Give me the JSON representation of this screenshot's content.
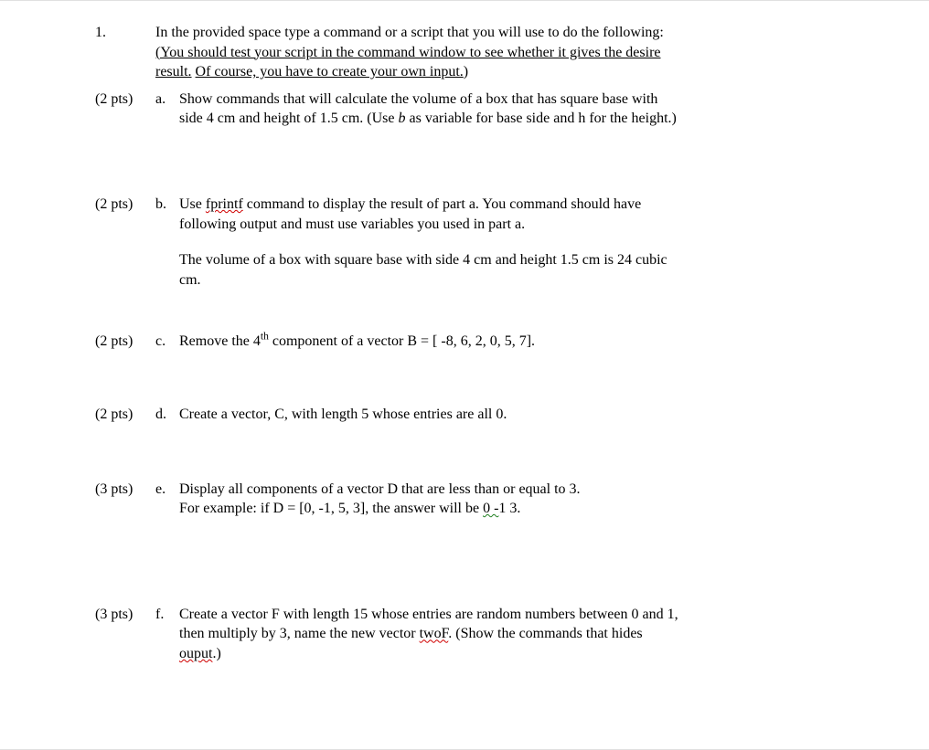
{
  "question_number": "1.",
  "intro": {
    "line1": "In the provided space type a command or a script that you will use to do the following:",
    "underlined_1": "(You should test your script in the command window to see whether it gives the desire",
    "underlined_2a": "result.",
    "underlined_2b": "Of course, you have to create your own input.",
    "paren_close": ")"
  },
  "parts": {
    "a": {
      "pts": "(2 pts)",
      "letter": "a.",
      "line1_a": "Show commands that will calculate the volume of a box that has square base with",
      "line2_pre": "side 4 cm and height of 1.5 cm. (Use ",
      "line2_var": "b",
      "line2_post": " as variable for base side and h for the height.)"
    },
    "b": {
      "pts": "(2 pts)",
      "letter": "b.",
      "line1_pre": "Use ",
      "line1_cmd": "fprintf",
      "line1_post": " command to display the result of part a. You command should have",
      "line2": "following output and must use variables you used in part a.",
      "line3": "The volume of a box with square base with side 4 cm and height 1.5 cm is 24 cubic",
      "line4": "cm."
    },
    "c": {
      "pts": "(2 pts)",
      "letter": "c.",
      "pre": "Remove the 4",
      "sup": "th",
      "post": " component of a vector B = [ -8, 6, 2, 0, 5, 7]."
    },
    "d": {
      "pts": "(2 pts)",
      "letter": "d.",
      "text": "Create a vector, C, with length 5 whose entries are all 0."
    },
    "e": {
      "pts": "(3 pts)",
      "letter": "e.",
      "line1": "Display all components of a vector D that are less than or equal to 3.",
      "line2_pre": "For example: if D = [0, -1, 5, 3], the answer will be   ",
      "line2_wavy": "0  -",
      "line2_post": "1 3."
    },
    "f": {
      "pts": "(3 pts)",
      "letter": "f.",
      "line1": "Create a vector F with length 15 whose entries are random numbers between 0 and 1,",
      "line2_pre": "then multiply by 3, name the new vector ",
      "line2_wavy": "twoF",
      "line2_post": ". (Show the commands that hides",
      "line3_wavy": "ouput",
      "line3_post": ".)"
    }
  }
}
